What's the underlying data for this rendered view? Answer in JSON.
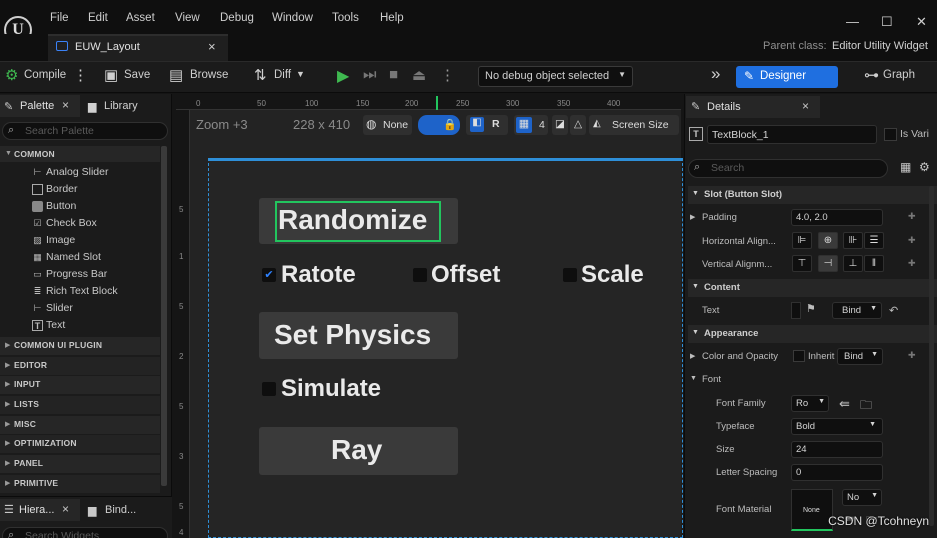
{
  "menu": [
    "File",
    "Edit",
    "Asset",
    "View",
    "Debug",
    "Window",
    "Tools",
    "Help"
  ],
  "window": {
    "minimize": "—",
    "maximize": "☐",
    "close": "✕"
  },
  "doc_tab": {
    "title": "EUW_Layout",
    "close": "×"
  },
  "parent_class": {
    "label": "Parent class:",
    "value": "Editor Utility Widget"
  },
  "toolbar": {
    "compile": "Compile",
    "save": "Save",
    "browse": "Browse",
    "diff": "Diff",
    "debug_object": "No debug object selected",
    "designer": "Designer",
    "graph": "Graph"
  },
  "palette": {
    "tab_palette": "Palette",
    "tab_library": "Library",
    "search_placeholder": "Search Palette",
    "common_label": "COMMON",
    "items": [
      "Analog Slider",
      "Border",
      "Button",
      "Check Box",
      "Image",
      "Named Slot",
      "Progress Bar",
      "Rich Text Block",
      "Slider",
      "Text"
    ],
    "categories": [
      "COMMON UI PLUGIN",
      "EDITOR",
      "INPUT",
      "LISTS",
      "MISC",
      "OPTIMIZATION",
      "PANEL",
      "PRIMITIVE"
    ],
    "bottom_tab_hier": "Hiera...",
    "bottom_tab_bind": "Bind...",
    "bottom_search": "Search Widgets"
  },
  "canvas": {
    "zoom": "Zoom +3",
    "size": "228 x 410",
    "none_label": "None",
    "r_label": "R",
    "grid_value": "4",
    "screen_size": "Screen Size",
    "ruler_h": [
      "0",
      "50",
      "100",
      "150",
      "200",
      "250",
      "300",
      "350",
      "400"
    ],
    "ruler_v": [
      "5",
      "1",
      "5",
      "2",
      "5",
      "3",
      "5",
      "4"
    ],
    "widgets": {
      "randomize": "Randomize",
      "ratote": "Ratote",
      "offset": "Offset",
      "scale": "Scale",
      "set_physics": "Set Physics",
      "simulate": "Simulate",
      "ray": "Ray"
    },
    "ratote_checked": true
  },
  "details": {
    "tab": "Details",
    "close": "×",
    "name": "TextBlock_1",
    "is_variable": "Is Vari",
    "search_placeholder": "Search",
    "slot_section": "Slot (Button Slot)",
    "padding_label": "Padding",
    "padding_value": "4.0, 2.0",
    "halign_label": "Horizontal Align...",
    "valign_label": "Vertical Alignm...",
    "content_section": "Content",
    "text_label": "Text",
    "bind": "Bind",
    "appearance_section": "Appearance",
    "color_label": "Color and Opacity",
    "inherit": "Inherit",
    "font_label": "Font",
    "font_family_label": "Font Family",
    "font_family_value": "Ro",
    "typeface_label": "Typeface",
    "typeface_value": "Bold",
    "size_label": "Size",
    "size_value": "24",
    "letter_spacing_label": "Letter Spacing",
    "letter_spacing_value": "0",
    "font_material_label": "Font Material",
    "font_material_value": "None",
    "font_material_no": "No"
  },
  "watermark": "CSDN @Tcohneyn",
  "colors": {
    "accent": "#1f6fe0",
    "selection": "#22c55e",
    "checkbox": "#2f82ff"
  }
}
